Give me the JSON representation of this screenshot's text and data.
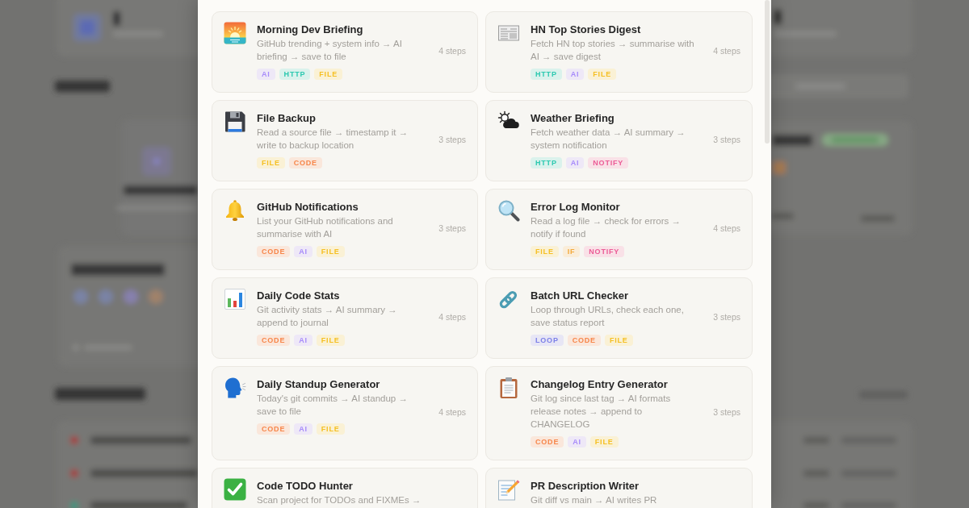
{
  "template_modal": {
    "templates": [
      {
        "title": "Morning Dev Briefing",
        "description": "GitHub trending + system info → AI briefing → save to file",
        "steps": "4 steps",
        "tags": [
          {
            "label": "AI",
            "color": "#a78bfa"
          },
          {
            "label": "HTTP",
            "color": "#2dc9b0"
          },
          {
            "label": "FILE",
            "color": "#f5bf22"
          }
        ]
      },
      {
        "title": "HN Top Stories Digest",
        "description": "Fetch HN top stories → summarise with AI → save digest",
        "steps": "4 steps",
        "tags": [
          {
            "label": "HTTP",
            "color": "#2dc9b0"
          },
          {
            "label": "AI",
            "color": "#a78bfa"
          },
          {
            "label": "FILE",
            "color": "#f5bf22"
          }
        ]
      },
      {
        "title": "File Backup",
        "description": "Read a source file → timestamp it → write to backup location",
        "steps": "3 steps",
        "tags": [
          {
            "label": "FILE",
            "color": "#f5bf22"
          },
          {
            "label": "CODE",
            "color": "#f7864a"
          }
        ]
      },
      {
        "title": "Weather Briefing",
        "description": "Fetch weather data → AI summary → system notification",
        "steps": "3 steps",
        "tags": [
          {
            "label": "HTTP",
            "color": "#2dc9b0"
          },
          {
            "label": "AI",
            "color": "#a78bfa"
          },
          {
            "label": "NOTIFY",
            "color": "#ec5b96"
          }
        ]
      },
      {
        "title": "GitHub Notifications",
        "description": "List your GitHub notifications and summarise with AI",
        "steps": "3 steps",
        "tags": [
          {
            "label": "CODE",
            "color": "#f7864a"
          },
          {
            "label": "AI",
            "color": "#a78bfa"
          },
          {
            "label": "FILE",
            "color": "#f5bf22"
          }
        ]
      },
      {
        "title": "Error Log Monitor",
        "description": "Read a log file → check for errors → notify if found",
        "steps": "4 steps",
        "tags": [
          {
            "label": "FILE",
            "color": "#f5bf22"
          },
          {
            "label": "IF",
            "color": "#f4a93a"
          },
          {
            "label": "NOTIFY",
            "color": "#ec5b96"
          }
        ]
      },
      {
        "title": "Daily Code Stats",
        "description": "Git activity stats → AI summary → append to journal",
        "steps": "4 steps",
        "tags": [
          {
            "label": "CODE",
            "color": "#f7864a"
          },
          {
            "label": "AI",
            "color": "#a78bfa"
          },
          {
            "label": "FILE",
            "color": "#f5bf22"
          }
        ]
      },
      {
        "title": "Batch URL Checker",
        "description": "Loop through URLs, check each one, save status report",
        "steps": "3 steps",
        "tags": [
          {
            "label": "LOOP",
            "color": "#7c80e8"
          },
          {
            "label": "CODE",
            "color": "#f7864a"
          },
          {
            "label": "FILE",
            "color": "#f5bf22"
          }
        ]
      },
      {
        "title": "Daily Standup Generator",
        "description": "Today's git commits → AI standup → save to file",
        "steps": "4 steps",
        "tags": [
          {
            "label": "CODE",
            "color": "#f7864a"
          },
          {
            "label": "AI",
            "color": "#a78bfa"
          },
          {
            "label": "FILE",
            "color": "#f5bf22"
          }
        ]
      },
      {
        "title": "Changelog Entry Generator",
        "description": "Git log since last tag → AI formats release notes → append to CHANGELOG",
        "steps": "3 steps",
        "tags": [
          {
            "label": "CODE",
            "color": "#f7864a"
          },
          {
            "label": "AI",
            "color": "#a78bfa"
          },
          {
            "label": "FILE",
            "color": "#f5bf22"
          }
        ]
      },
      {
        "title": "Code TODO Hunter",
        "description": "Scan project for TODOs and FIXMEs →"
      },
      {
        "title": "PR Description Writer",
        "description": "Git diff vs main → AI writes PR"
      }
    ]
  }
}
